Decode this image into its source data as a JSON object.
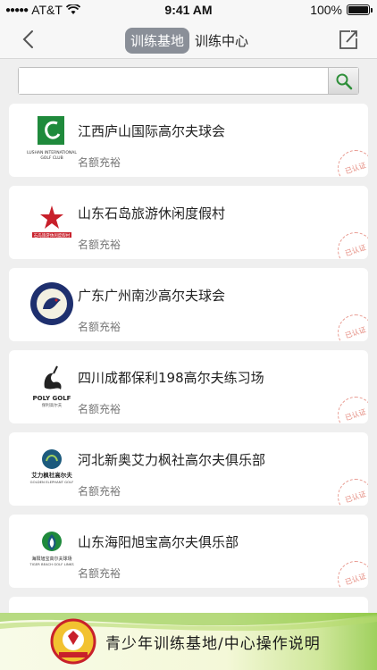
{
  "status_bar": {
    "carrier": "AT&T",
    "time": "9:41 AM",
    "battery": "100%",
    "signal_icon": "signal-icon",
    "wifi_icon": "wifi-icon"
  },
  "nav": {
    "back_icon": "chevron-left-icon",
    "share_icon": "share-icon",
    "tabs": [
      {
        "label": "训练基地",
        "active": true
      },
      {
        "label": "训练中心",
        "active": false
      }
    ]
  },
  "search": {
    "value": "",
    "placeholder": "",
    "button_icon": "search-icon"
  },
  "clubs": [
    {
      "name": "江西庐山国际高尔夫球会",
      "quota": "名额充裕",
      "stamp": "已认证",
      "logo_text": "LUSHAN INTERNATIONAL"
    },
    {
      "name": "山东石岛旅游休闲度假村",
      "quota": "名额充裕",
      "stamp": "已认证",
      "logo_text": "石岛旅游休闲度假村"
    },
    {
      "name": "广东广州南沙高尔夫球会",
      "quota": "名额充裕",
      "stamp": "已认证",
      "logo_text": ""
    },
    {
      "name": "四川成都保利198高尔夫练习场",
      "quota": "名额充裕",
      "stamp": "已认证",
      "logo_text": "POLY GOLF"
    },
    {
      "name": "河北新奥艾力枫社高尔夫俱乐部",
      "quota": "名额充裕",
      "stamp": "已认证",
      "logo_text": "艾力枫社高尔夫"
    },
    {
      "name": "山东海阳旭宝高尔夫俱乐部",
      "quota": "名额充裕",
      "stamp": "已认证",
      "logo_text": "TIGER BEACH GOLF LINKS"
    }
  ],
  "banner": {
    "text": "青少年训练基地/中心操作说明"
  },
  "colors": {
    "segment_active": "#8a8f98",
    "stamp": "#e4877b",
    "banner_green": "#9fd05e"
  }
}
